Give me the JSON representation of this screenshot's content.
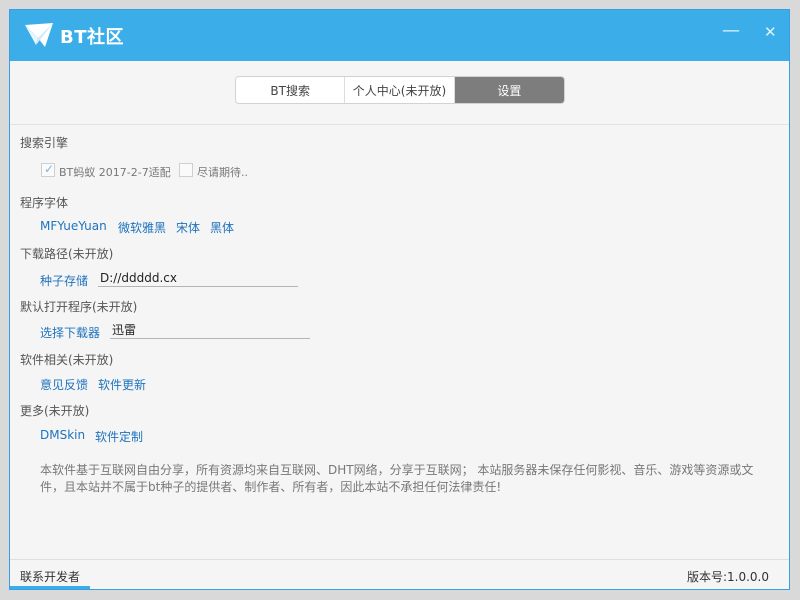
{
  "window": {
    "title": "BT社区",
    "minimize_glyph": "—",
    "close_glyph": "✕",
    "accent_color": "#3baee9",
    "icon": "paper-plane-logo-icon"
  },
  "tabs": [
    {
      "label": "BT搜索",
      "active": false
    },
    {
      "label": "个人中心(未开放)",
      "active": false
    },
    {
      "label": "设置",
      "active": true
    }
  ],
  "search_engine": {
    "label": "搜索引擎",
    "options": [
      {
        "label": "BT蚂蚁 2017-2-7适配",
        "checked": true
      },
      {
        "label": "尽请期待..",
        "checked": false
      }
    ]
  },
  "font": {
    "label": "程序字体",
    "options": [
      "MFYueYuan",
      "微软雅黑",
      "宋体",
      "黑体"
    ]
  },
  "download_path": {
    "label": "下载路径(未开放)",
    "button": "种子存储",
    "value": "D://ddddd.cx"
  },
  "default_program": {
    "label": "默认打开程序(未开放)",
    "button": "选择下载器",
    "value": "迅雷"
  },
  "software": {
    "label": "软件相关(未开放)",
    "links": [
      "意见反馈",
      "软件更新"
    ]
  },
  "more": {
    "label": "更多(未开放)",
    "links": [
      "DMSkin",
      "软件定制"
    ]
  },
  "disclaimer": "本软件基于互联网自由分享，所有资源均来自互联网、DHT网络，分享于互联网； 本站服务器未保存任何影视、音乐、游戏等资源或文件，且本站并不属于bt种子的提供者、制作者、所有者，因此本站不承担任何法律责任!",
  "status": {
    "contact": "联系开发者",
    "version": "版本号:1.0.0.0"
  }
}
